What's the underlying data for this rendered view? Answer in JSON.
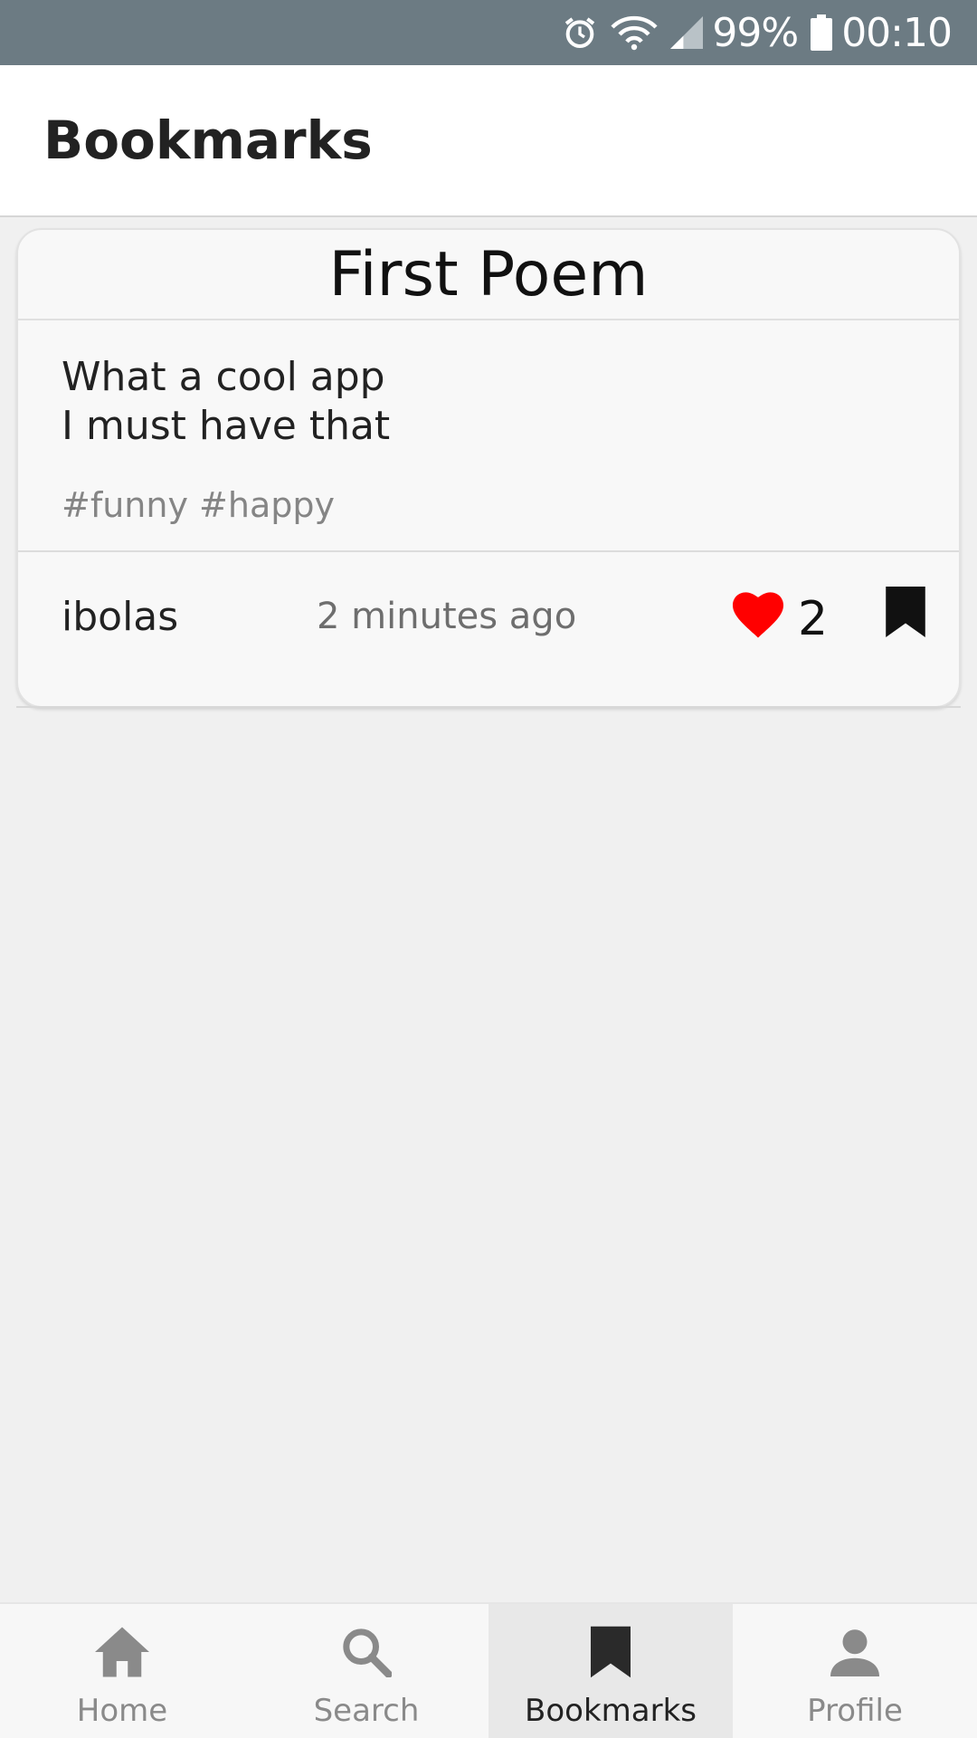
{
  "status_bar": {
    "battery": "99%",
    "time": "00:10",
    "icons": [
      "alarm-icon",
      "wifi-icon",
      "signal-icon",
      "battery-icon"
    ]
  },
  "header": {
    "title": "Bookmarks"
  },
  "poems": [
    {
      "title": "First Poem",
      "lines": [
        "What a cool app",
        "I must have that"
      ],
      "tags": "#funny #happy",
      "author": "ibolas",
      "time_ago": "2 minutes ago",
      "likes": "2",
      "liked": true,
      "bookmarked": true
    }
  ],
  "nav": {
    "items": [
      {
        "label": "Home",
        "icon": "home-icon"
      },
      {
        "label": "Search",
        "icon": "search-icon"
      },
      {
        "label": "Bookmarks",
        "icon": "bookmark-icon",
        "active": true
      },
      {
        "label": "Profile",
        "icon": "person-icon"
      }
    ]
  },
  "colors": {
    "status_bar": "#6c7b83",
    "like": "#ff0000",
    "active_tab": "#e8e8e8"
  }
}
